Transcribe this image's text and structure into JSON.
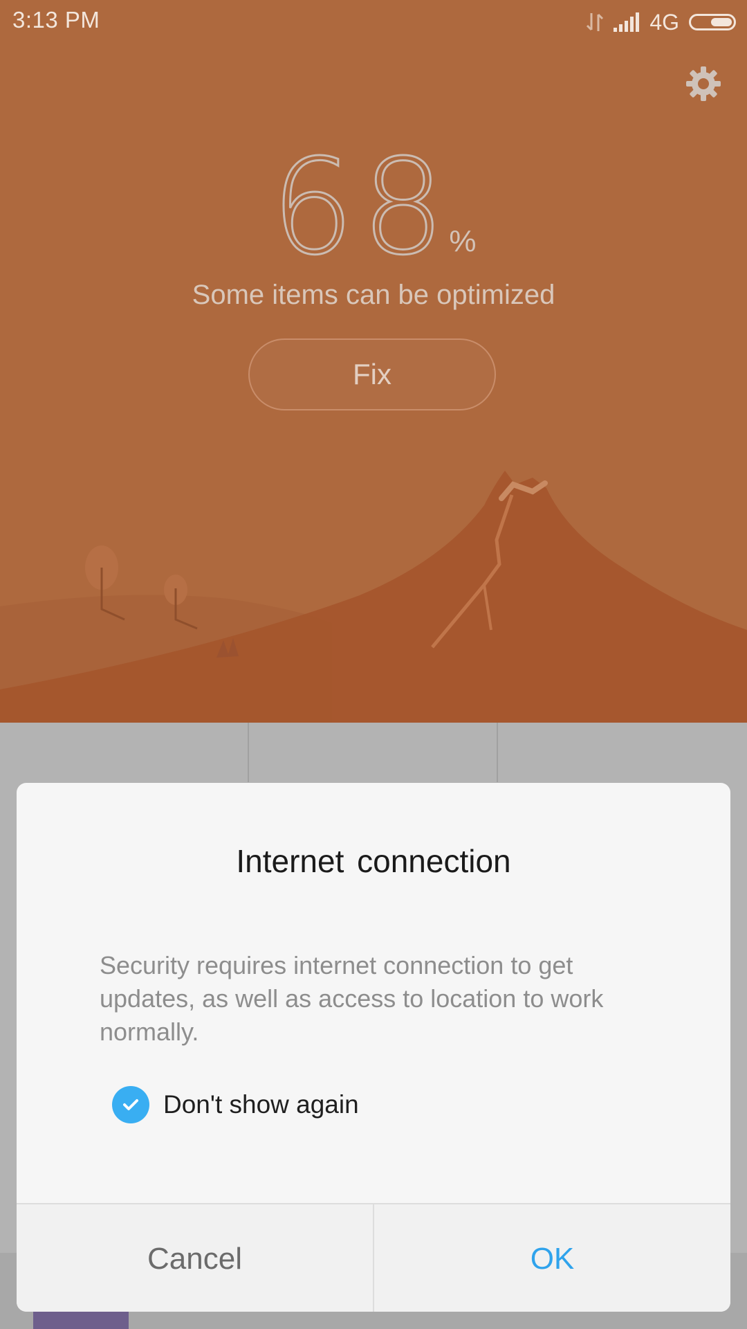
{
  "status_bar": {
    "time": "3:13  PM",
    "network": "4G"
  },
  "header": {
    "score_value": "68",
    "score_unit": "%",
    "caption": "Some items can be optimized",
    "fix_label": "Fix"
  },
  "dialog": {
    "title": "Internet  connection",
    "message": "Security requires internet connection to get updates, as well as access to location to work normally.",
    "checkbox_label": "Don't show again",
    "checkbox_checked": true,
    "cancel_label": "Cancel",
    "ok_label": "OK"
  },
  "colors": {
    "header_bg": "#ae693e",
    "accent": "#39aef2",
    "ok_text": "#2fa3ec"
  },
  "icons": {
    "settings": "gear-icon",
    "checkbox": "check-icon",
    "signal": "signal-icon",
    "battery": "battery-icon",
    "data": "data-transfer-icon"
  }
}
